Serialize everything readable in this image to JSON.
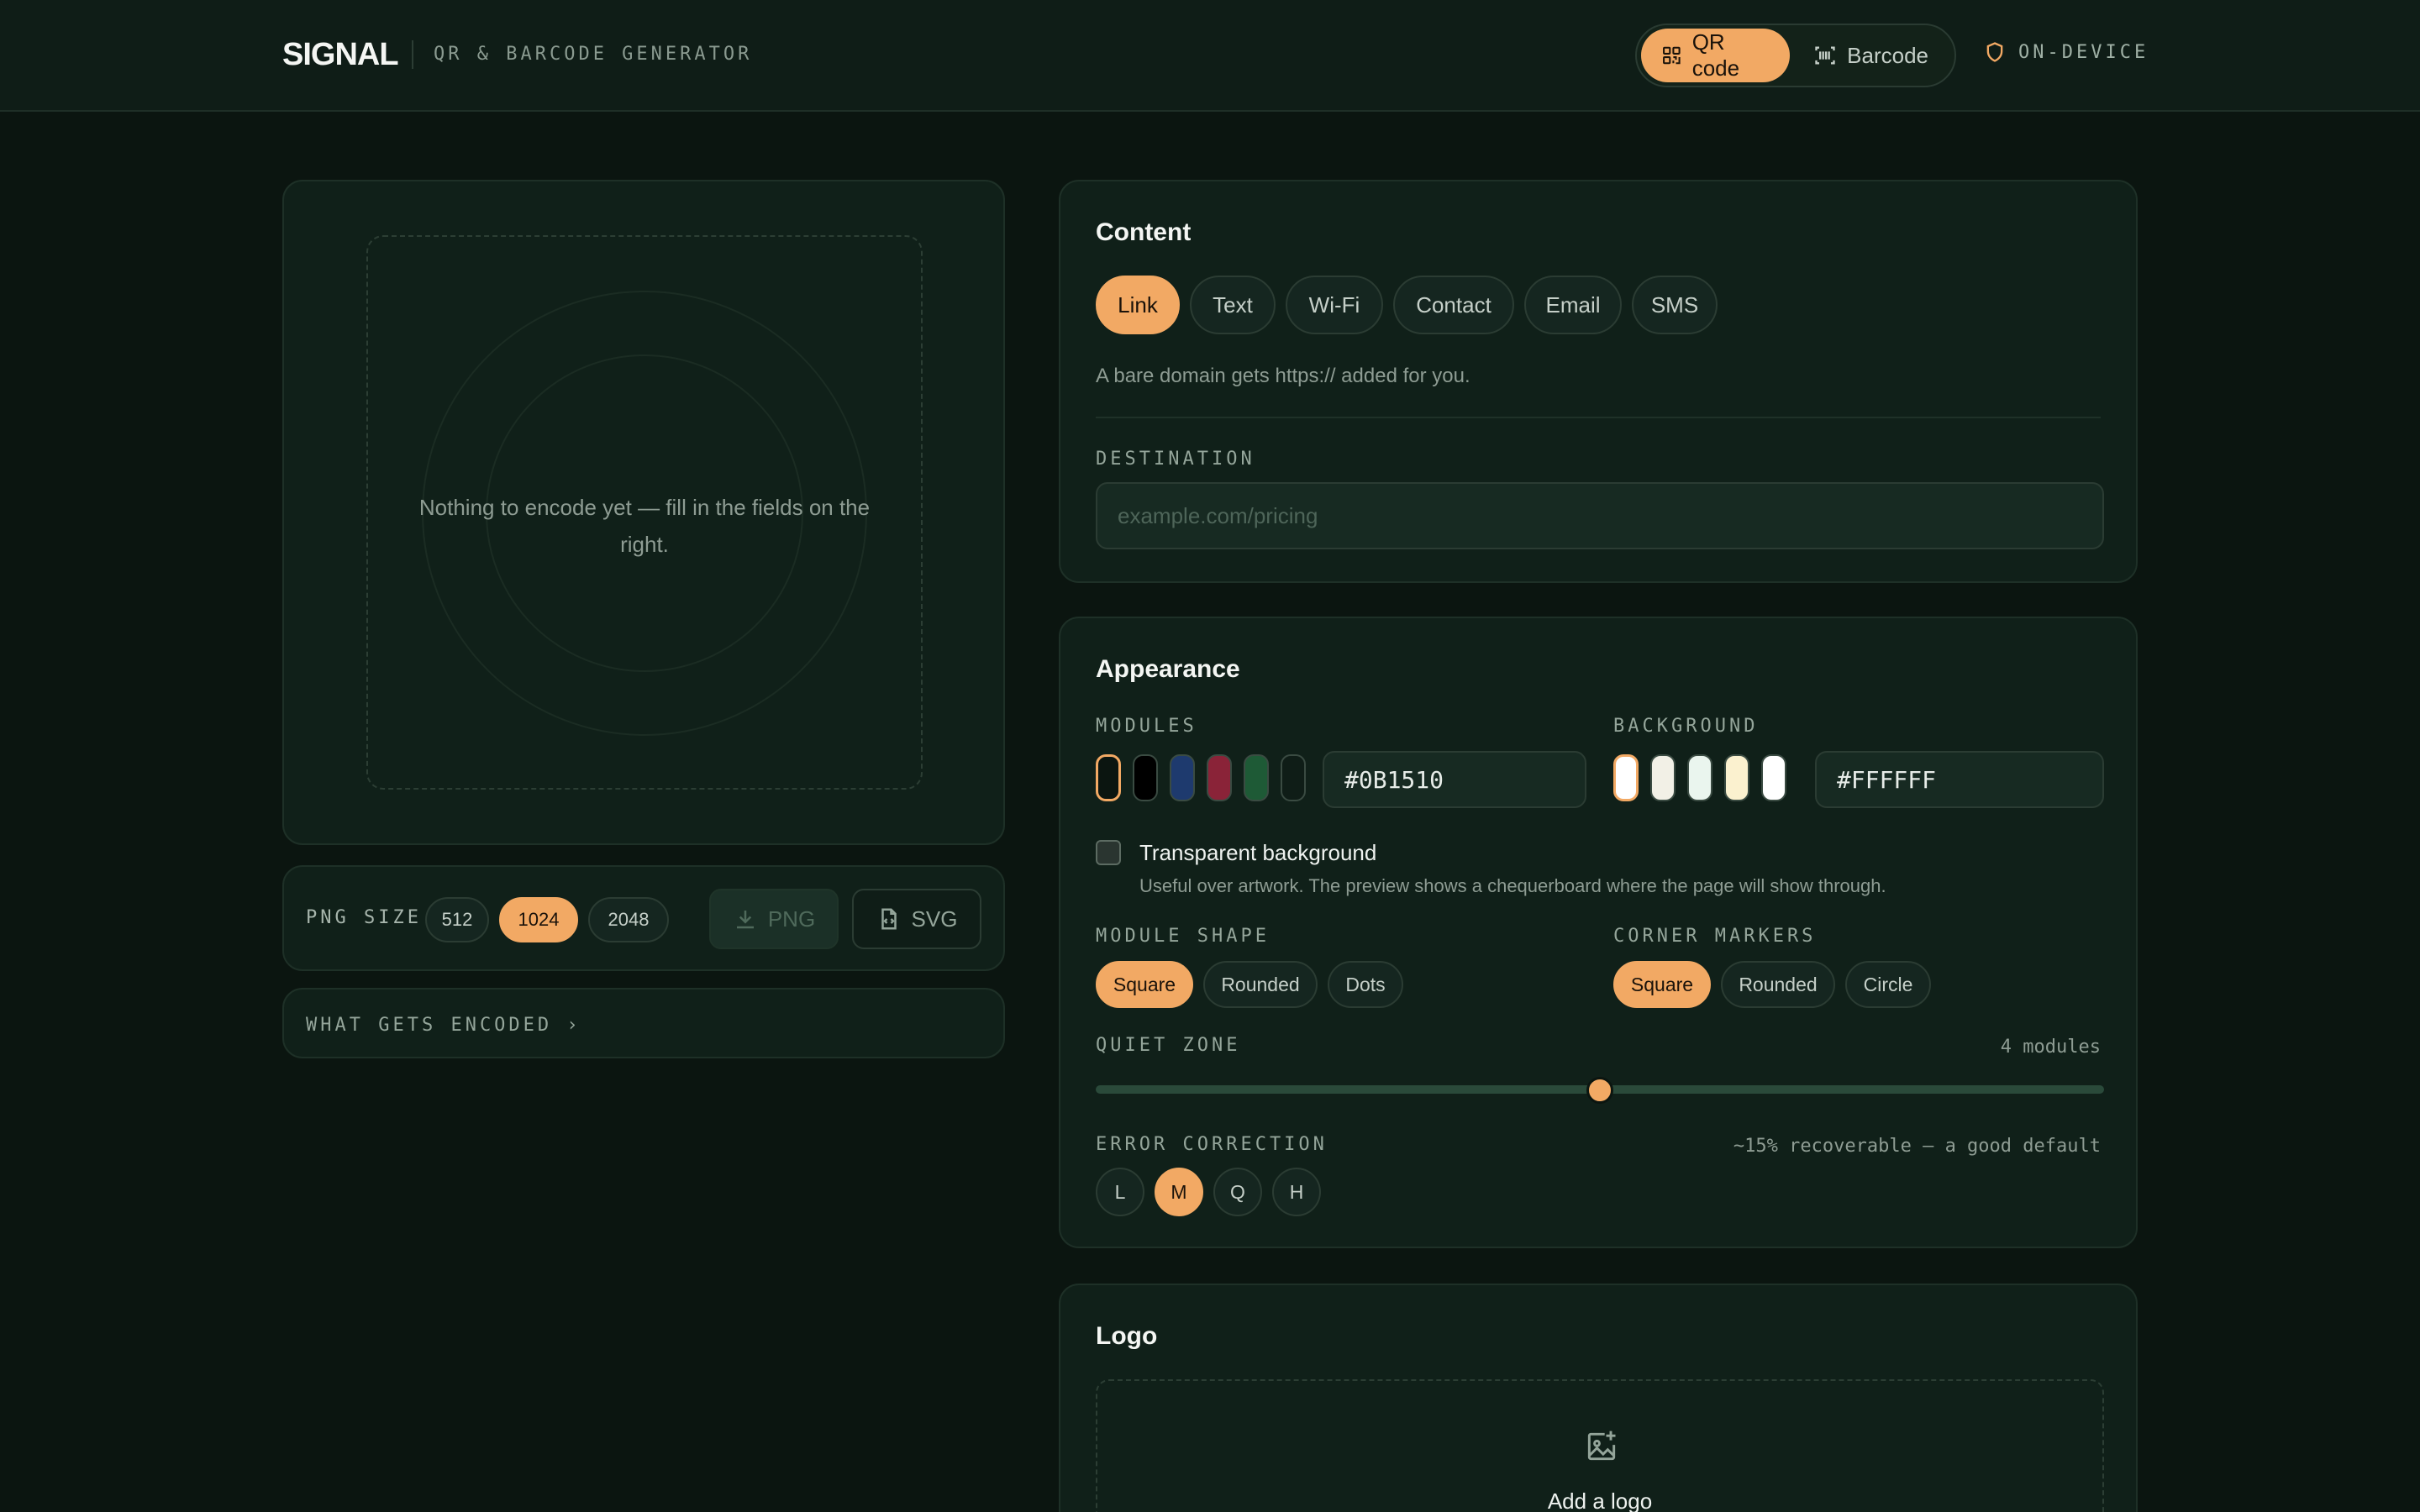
{
  "header": {
    "brand": "SIGNAL",
    "subtitle": "QR & BARCODE GENERATOR",
    "modes": [
      {
        "label": "QR code",
        "icon": "qr-icon",
        "active": true
      },
      {
        "label": "Barcode",
        "icon": "barcode-icon",
        "active": false
      }
    ],
    "on_device": "ON-DEVICE"
  },
  "preview": {
    "empty_message": "Nothing to encode yet — fill in the fields on the right."
  },
  "export": {
    "size_label": "PNG SIZE",
    "sizes": [
      "512",
      "1024",
      "2048"
    ],
    "selected_size": "1024",
    "png_label": "PNG",
    "svg_label": "SVG"
  },
  "encoded": {
    "label": "WHAT GETS ENCODED ›"
  },
  "content": {
    "title": "Content",
    "tabs": [
      "Link",
      "Text",
      "Wi-Fi",
      "Contact",
      "Email",
      "SMS"
    ],
    "active_tab": "Link",
    "hint": "A bare domain gets https:// added for you.",
    "destination_label": "DESTINATION",
    "destination_placeholder": "example.com/pricing",
    "destination_value": ""
  },
  "appearance": {
    "title": "Appearance",
    "modules_label": "MODULES",
    "module_swatches": [
      "#0B1510",
      "#000000",
      "#1E3A6E",
      "#8A2338",
      "#1E5A36",
      "#0F1D17"
    ],
    "module_hex": "#0B1510",
    "background_label": "BACKGROUND",
    "background_swatches": [
      "#FFFFFF",
      "#F2F0E6",
      "#EAF5EE",
      "#FBF1CF",
      "#FFFFFF"
    ],
    "background_hex": "#FFFFFF",
    "transparent_label": "Transparent background",
    "transparent_desc": "Useful over artwork. The preview shows a chequerboard where the page will show through.",
    "transparent_checked": false,
    "module_shape_label": "MODULE SHAPE",
    "module_shapes": [
      "Square",
      "Rounded",
      "Dots"
    ],
    "module_shape_active": "Square",
    "corner_label": "CORNER MARKERS",
    "corners": [
      "Square",
      "Rounded",
      "Circle"
    ],
    "corner_active": "Square",
    "quiet_zone_label": "QUIET ZONE",
    "quiet_zone_value": "4 modules",
    "quiet_zone_fraction": 0.5,
    "error_label": "ERROR CORRECTION",
    "error_note": "~15% recoverable — a good default",
    "error_levels": [
      "L",
      "M",
      "Q",
      "H"
    ],
    "error_active": "M"
  },
  "logo": {
    "title": "Logo",
    "add_label": "Add a logo"
  },
  "colors": {
    "accent": "#F2A964",
    "background": "#0B1510",
    "panel": "#102019"
  }
}
